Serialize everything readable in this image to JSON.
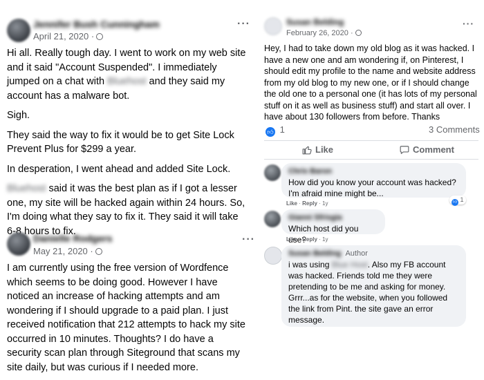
{
  "left_post_1": {
    "author": "Jennifer Bush Cunningham",
    "date": "April 21, 2020 ·",
    "more": "···",
    "p1_a": "Hi all. Really tough day. I went to work on my web site and it said \"Account Suspended\". I immediately jumped on a chat with ",
    "p1_host": "Bluehost",
    "p1_b": " and they said my account has a malware bot.",
    "p2": "Sigh.",
    "p3": "They said the way to fix it would be to get Site Lock Prevent Plus for $299 a year.",
    "p4": "In desperation, I went ahead and added Site Lock.",
    "p5_host": "Bluehost",
    "p5_b": " said it was the best plan as if I got a lesser one, my site will be hacked again within 24 hours. So, I'm doing what they say to fix it. They said it will take 6-8 hours to fix."
  },
  "left_post_2": {
    "author": "Danielle Rodgers",
    "date": "May 21, 2020 ·",
    "more": "···",
    "text": "I am currently using the free version of Wordfence which seems to be doing good. However I have noticed an increase of hacking attempts and am wondering if I should upgrade to a paid plan. I just received notification that 212 attempts to hack my site occurred in 10 minutes. Thoughts? I do have a security scan plan through Siteground that scans my site daily, but was curious  if I needed more."
  },
  "right_post": {
    "author": "Susan Belding",
    "date": "February 26, 2020 ·",
    "more": "···",
    "text": "Hey, I had to take down my old blog as it was hacked.  I have a new one and am wondering if, on Pinterest, I should edit my profile to the name and website address from my old blog to my new one, or if I should change the old one to a personal one (it has lots of my personal stuff on it as well as business stuff) and start all over.  I have about 130 followers from before.  Thanks",
    "like_count": "1",
    "comments_count": "3 Comments",
    "like_label": "Like",
    "comment_label": "Comment",
    "like_icon": "thumbs-up-icon",
    "comment_icon": "speech-bubble-icon"
  },
  "comments": [
    {
      "name": "Chris Baron",
      "text": "How did you know your account was hacked? I'm afraid mine might be...",
      "like": "Like",
      "reply": "Reply",
      "time": "1y",
      "reaction": "1"
    },
    {
      "name": "Gianni Sfrisgia",
      "text": "Which host did you use?",
      "like": "Like",
      "reply": "Reply",
      "time": "1y"
    },
    {
      "name": "Susan Belding",
      "badge": "Author",
      "text_a": "i was using ",
      "text_host": "Blue Host",
      "text_b": ". Also my FB account was hacked. Friends told me they were pretending to be me and asking for money. Grrr...as for the website, when you followed the link from Pint. the site gave an error message."
    }
  ],
  "colors": {
    "accent": "#1877f2",
    "bubble": "#f0f2f5",
    "muted": "#65676b"
  }
}
